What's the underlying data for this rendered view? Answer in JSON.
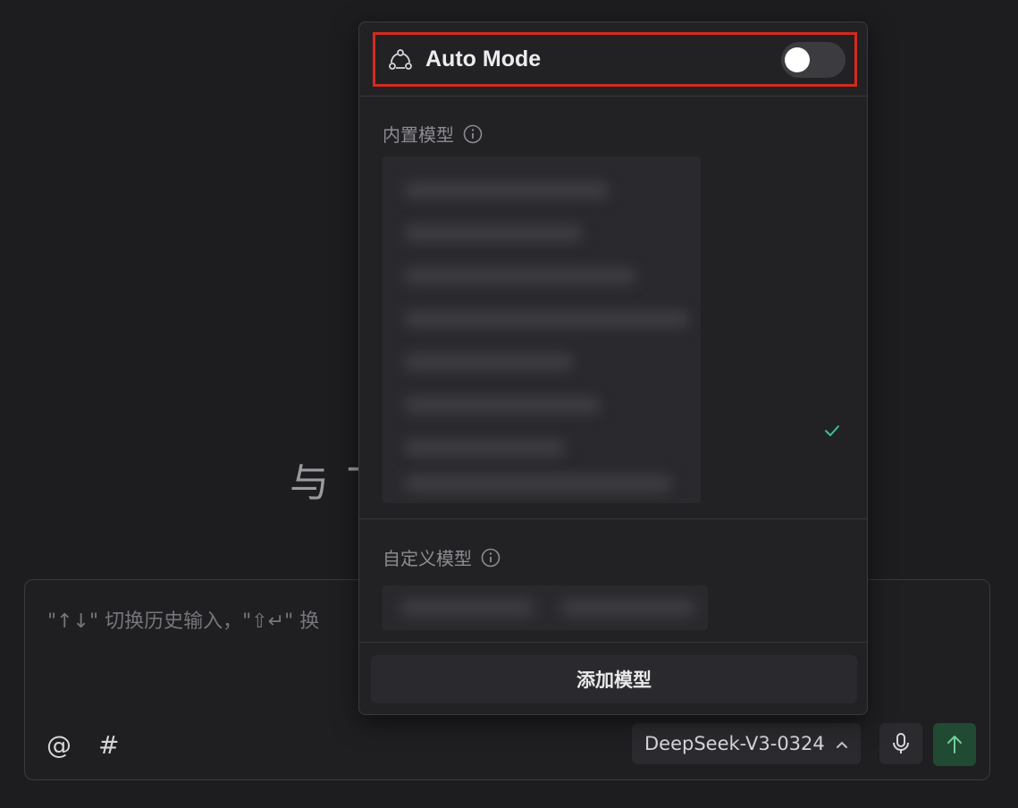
{
  "background": {
    "welcome_fragment": "与 T"
  },
  "input": {
    "placeholder": "\"↑↓\" 切换历史输入，\"⇧↵\" 换",
    "mention_symbol": "@",
    "hash_symbol": "#",
    "model_selected": "DeepSeek-V3-0324",
    "mic_icon": "microphone-icon",
    "send_icon": "arrow-up-icon"
  },
  "popup": {
    "auto_mode": {
      "label": "Auto Mode",
      "enabled": false,
      "highlight_color": "#d42a1e"
    },
    "builtin_section": {
      "title": "内置模型",
      "selected_check_color": "#3ec28f"
    },
    "custom_section": {
      "title": "自定义模型"
    },
    "add_model_label": "添加模型"
  },
  "colors": {
    "background": "#1d1d1f",
    "popup_bg": "#222225",
    "send_button_bg": "#214a33",
    "send_arrow": "#6fcf97"
  }
}
